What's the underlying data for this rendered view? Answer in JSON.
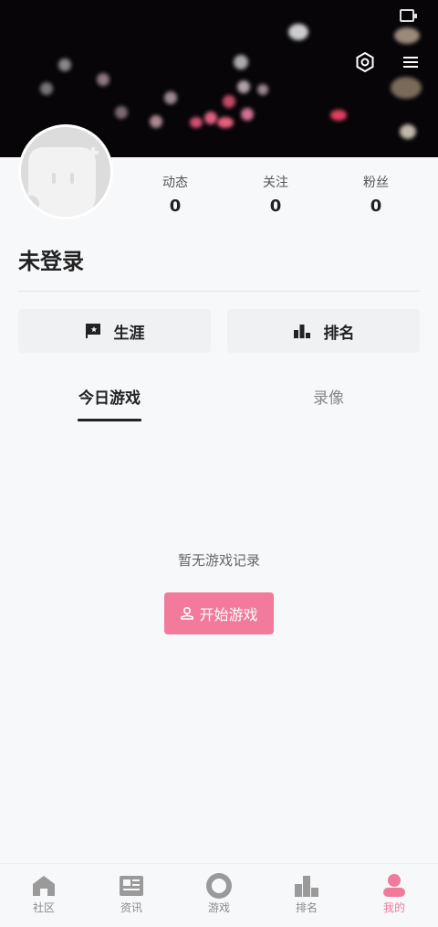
{
  "stats": [
    {
      "label": "动态",
      "value": "0"
    },
    {
      "label": "关注",
      "value": "0"
    },
    {
      "label": "粉丝",
      "value": "0"
    }
  ],
  "user": {
    "name": "未登录"
  },
  "actions": {
    "career": "生涯",
    "ranking": "排名"
  },
  "tabs": {
    "today": "今日游戏",
    "replay": "录像"
  },
  "empty": {
    "message": "暂无游戏记录",
    "start_button": "开始游戏"
  },
  "nav": [
    {
      "label": "社区",
      "icon": "home-icon"
    },
    {
      "label": "资讯",
      "icon": "news-icon"
    },
    {
      "label": "游戏",
      "icon": "game-icon"
    },
    {
      "label": "排名",
      "icon": "ranking-icon"
    },
    {
      "label": "我的",
      "icon": "profile-icon"
    }
  ],
  "colors": {
    "accent": "#f27a9b",
    "nav_active": "#f07a9b",
    "nav_inactive": "#8a8a8a"
  }
}
